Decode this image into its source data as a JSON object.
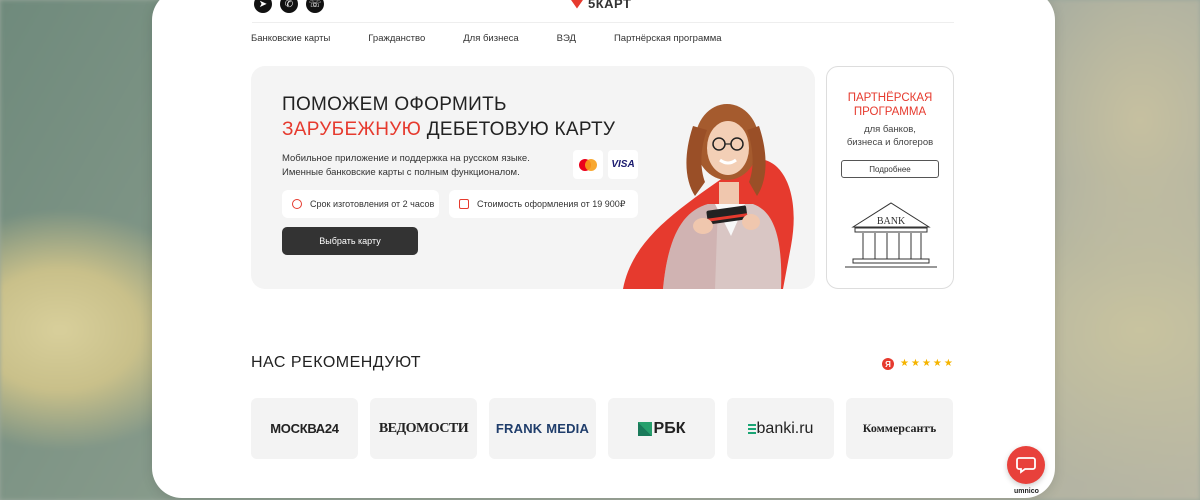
{
  "header": {
    "logo_text": "5КАРТ",
    "social_icons": [
      "telegram-icon",
      "whatsapp-icon",
      "viber-icon"
    ]
  },
  "nav": {
    "items": [
      "Банковские карты",
      "Гражданство",
      "Для бизнеса",
      "ВЭД",
      "Партнёрская программа"
    ]
  },
  "hero": {
    "title_line1": "ПОМОЖЕМ ОФОРМИТЬ",
    "title_red": "ЗАРУБЕЖНУЮ",
    "title_line2_rest": " ДЕБЕТОВУЮ КАРТУ",
    "desc_line1": "Мобильное приложение и поддержка на русском языке.",
    "desc_line2": "Именные банковские карты с полным функционалом.",
    "payment_visa": "VISA",
    "chip_time": "Срок изготовления от 2 часов",
    "chip_cost": "Стоимость оформления от 19 900₽",
    "cta_label": "Выбрать карту"
  },
  "partner": {
    "title": "ПАРТНЁРСКАЯ\nПРОГРАММА",
    "subtitle": "для банков,\nбизнеса и блогеров",
    "button_label": "Подробнее",
    "bank_label": "BANK"
  },
  "recommend": {
    "title": "НАС РЕКОМЕНДУЮТ",
    "rating_badge": "Я",
    "stars": 5,
    "logos": [
      "МОСКВА24",
      "ВЕДОМОСТИ",
      "FRANK MEDIA",
      "РБК",
      "banki.ru",
      "Коммерсантъ"
    ]
  },
  "widget": {
    "label": "umnico"
  },
  "colors": {
    "accent": "#e63a2e",
    "dark_button": "#333333",
    "hero_bg": "#f4f4f4"
  }
}
